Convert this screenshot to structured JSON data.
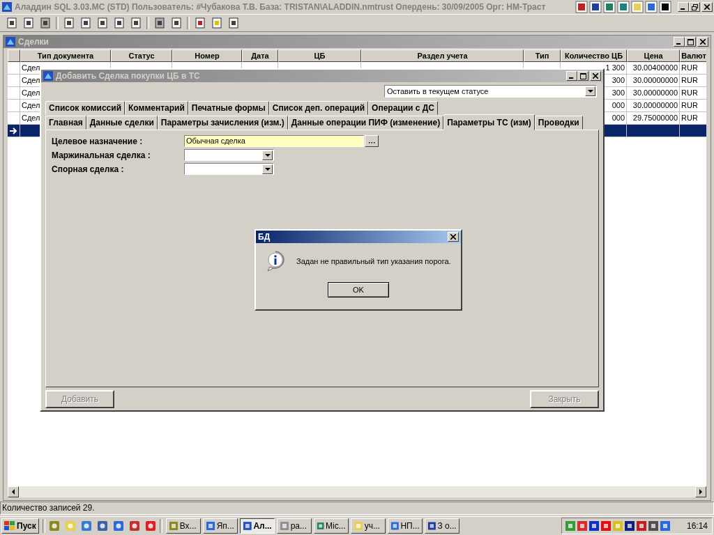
{
  "app_window": {
    "title": "Аладдин SQL 3.03.MC (STD)  Пользователь: #Чубакова Т.В. База: TRISTAN\\ALADDIN.nmtrust Опердень: 30/09/2005 Орг: НМ-Траст"
  },
  "child_window": {
    "title": "Сделки"
  },
  "table": {
    "columns": [
      "Тип документа",
      "Статус",
      "Номер",
      "Дата",
      "ЦБ",
      "Раздел учета",
      "Тип",
      "Количество ЦБ",
      "Цена",
      "Валют"
    ],
    "rows": [
      {
        "selected": false,
        "cells": [
          "Сдел",
          "",
          "",
          "",
          "",
          "",
          "",
          "1 300",
          "30.00400000",
          "RUR"
        ]
      },
      {
        "selected": false,
        "cells": [
          "Сдел",
          "",
          "",
          "",
          "",
          "",
          "",
          "300",
          "30.00000000",
          "RUR"
        ]
      },
      {
        "selected": false,
        "cells": [
          "Сдел",
          "",
          "",
          "",
          "",
          "",
          "",
          "300",
          "30.00000000",
          "RUR"
        ]
      },
      {
        "selected": false,
        "cells": [
          "Сдел",
          "",
          "",
          "",
          "",
          "",
          "",
          "000",
          "30.00000000",
          "RUR"
        ]
      },
      {
        "selected": false,
        "cells": [
          "Сдел",
          "",
          "",
          "",
          "",
          "",
          "",
          "000",
          "29.75000000",
          "RUR"
        ]
      },
      {
        "selected": true,
        "cells": [
          "",
          "",
          "",
          "",
          "",
          "",
          "",
          "",
          "",
          ""
        ]
      }
    ]
  },
  "dialog": {
    "title": "Добавить Сделка покупки ЦБ в ТС",
    "status_select": {
      "value": "Оставить в текущем статусе"
    },
    "tab_rows": [
      [
        {
          "label": "Список комиссий",
          "selected": false
        },
        {
          "label": "Комментарий",
          "selected": false
        },
        {
          "label": "Печатные формы",
          "selected": false
        },
        {
          "label": "Список деп. операций",
          "selected": false
        },
        {
          "label": "Операции с ДС",
          "selected": false
        }
      ],
      [
        {
          "label": "Главная",
          "selected": false
        },
        {
          "label": "Данные сделки",
          "selected": false
        },
        {
          "label": "Параметры зачисления (изм.)",
          "selected": false
        },
        {
          "label": "Данные операции ПИФ (изменение)",
          "selected": false
        },
        {
          "label": "Параметры ТС (изм)",
          "selected": true
        },
        {
          "label": "Проводки",
          "selected": false
        }
      ]
    ],
    "fields": [
      {
        "kind": "lookup",
        "label": "Целевое назначение :",
        "value": "Обычная сделка"
      },
      {
        "kind": "dropdown",
        "label": "Маржинальная сделка :"
      },
      {
        "kind": "dropdown",
        "label": "Спорная сделка :"
      }
    ],
    "buttons": [
      {
        "label": "Добавить",
        "disabled": true
      },
      {
        "label": "Закрыть",
        "disabled": true
      }
    ]
  },
  "message_box": {
    "title": "БД",
    "message": "Задан не правильный тип указания порога.",
    "button": "OK"
  },
  "status_bar": {
    "text": "Количество записей 29."
  },
  "taskbar": {
    "start": "Пуск",
    "tasks": [
      {
        "label": "Вх...",
        "selected": false
      },
      {
        "label": "Яп...",
        "selected": false
      },
      {
        "label": "Ал...",
        "selected": true
      },
      {
        "label": "ра...",
        "selected": false
      },
      {
        "label": "Mic...",
        "selected": false
      },
      {
        "label": "уч...",
        "selected": false
      },
      {
        "label": "НП...",
        "selected": false
      },
      {
        "label": "З о...",
        "selected": false
      }
    ],
    "clock": "16:14"
  }
}
